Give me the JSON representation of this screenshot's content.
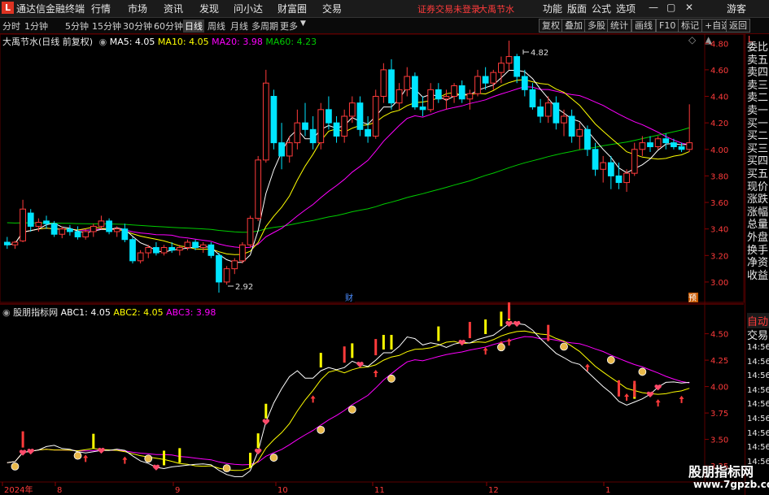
{
  "titlebar": {
    "app_name": "通达信金融终端",
    "menus": [
      "行情",
      "市场",
      "资讯",
      "发现",
      "问小达",
      "财富圈",
      "交易"
    ],
    "notice": "证券交易未登录",
    "stock_name": "大禹节水",
    "right_menus": [
      "功能",
      "版面",
      "公式",
      "选项"
    ],
    "guest": "游客"
  },
  "toolbar": {
    "periods": [
      "分时",
      "1分钟",
      "5分钟",
      "15分钟",
      "30分钟",
      "60分钟",
      "日线",
      "周线",
      "月线",
      "多周期",
      "更多"
    ],
    "active_period": "日线",
    "right_buttons": [
      "复权",
      "叠加",
      "多股",
      "统计",
      "画线",
      "F10",
      "标记",
      "+自选",
      "返回"
    ]
  },
  "main_info": {
    "title": "大禹节水(日线 前复权)",
    "ma5": "MA5: 4.05",
    "ma10": "MA10: 4.05",
    "ma20": "MA20: 3.98",
    "ma60": "MA60: 4.23"
  },
  "sub_info": {
    "title": "股朋指标网",
    "abc1": "ABC1: 4.05",
    "abc2": "ABC2: 4.05",
    "abc3": "ABC3: 3.98"
  },
  "markers": {
    "high_label": "4.82",
    "low_label": "2.92",
    "cai": "财",
    "yu": "预"
  },
  "price_axis": [
    "4.80",
    "4.60",
    "4.40",
    "4.20",
    "4.00",
    "3.80",
    "3.60",
    "3.40",
    "3.20",
    "3.00"
  ],
  "sub_axis": [
    "4.50",
    "4.25",
    "4.00",
    "3.75",
    "3.50",
    "3.25"
  ],
  "date_axis": [
    "2024年",
    "8",
    "9",
    "10",
    "11",
    "12",
    "1"
  ],
  "right_panel": {
    "top_items": [
      "委比",
      "卖五",
      "卖四",
      "卖三",
      "卖二",
      "卖一",
      "买一",
      "买二",
      "买三",
      "买四",
      "买五",
      "现价",
      "涨跌",
      "涨幅",
      "总量",
      "外盘",
      "换手",
      "净资",
      "收益"
    ],
    "bottom_tabs": [
      "自动",
      "交易"
    ],
    "times": [
      "14:56",
      "14:56",
      "14:56",
      "14:56",
      "14:56",
      "14:56",
      "14:56",
      "14:56",
      "14:56"
    ]
  },
  "watermark": {
    "line1": "股朋指标网",
    "line2": "www.7gpzb.com"
  },
  "colors": {
    "up": "#ff3b3b",
    "down": "#00e5ff",
    "ma5": "#ffffff",
    "ma10": "#ffff00",
    "ma20": "#ff00ff",
    "ma60": "#00cc00"
  },
  "chart_data": {
    "type": "candlestick",
    "candles": [
      [
        3.3,
        3.34,
        3.25,
        3.28
      ],
      [
        3.28,
        3.31,
        3.25,
        3.3
      ],
      [
        3.31,
        3.62,
        3.3,
        3.55
      ],
      [
        3.52,
        3.55,
        3.38,
        3.42
      ],
      [
        3.42,
        3.48,
        3.38,
        3.45
      ],
      [
        3.46,
        3.5,
        3.4,
        3.44
      ],
      [
        3.44,
        3.46,
        3.34,
        3.36
      ],
      [
        3.36,
        3.42,
        3.33,
        3.4
      ],
      [
        3.4,
        3.43,
        3.35,
        3.38
      ],
      [
        3.38,
        3.42,
        3.32,
        3.34
      ],
      [
        3.34,
        3.4,
        3.32,
        3.38
      ],
      [
        3.38,
        3.44,
        3.34,
        3.42
      ],
      [
        3.42,
        3.5,
        3.4,
        3.46
      ],
      [
        3.46,
        3.48,
        3.36,
        3.38
      ],
      [
        3.38,
        3.42,
        3.34,
        3.4
      ],
      [
        3.4,
        3.44,
        3.3,
        3.32
      ],
      [
        3.32,
        3.34,
        3.14,
        3.16
      ],
      [
        3.16,
        3.24,
        3.14,
        3.22
      ],
      [
        3.22,
        3.28,
        3.18,
        3.26
      ],
      [
        3.26,
        3.3,
        3.2,
        3.22
      ],
      [
        3.22,
        3.28,
        3.2,
        3.26
      ],
      [
        3.26,
        3.3,
        3.22,
        3.24
      ],
      [
        3.24,
        3.28,
        3.2,
        3.26
      ],
      [
        3.26,
        3.32,
        3.24,
        3.3
      ],
      [
        3.3,
        3.32,
        3.24,
        3.26
      ],
      [
        3.26,
        3.3,
        3.22,
        3.28
      ],
      [
        3.28,
        3.3,
        3.18,
        3.2
      ],
      [
        3.2,
        3.22,
        2.92,
        3.0
      ],
      [
        3.0,
        3.12,
        2.98,
        3.1
      ],
      [
        3.1,
        3.18,
        3.06,
        3.16
      ],
      [
        3.16,
        3.3,
        3.14,
        3.28
      ],
      [
        3.28,
        3.5,
        3.26,
        3.48
      ],
      [
        3.48,
        3.95,
        3.46,
        3.92
      ],
      [
        3.92,
        4.6,
        3.9,
        4.5
      ],
      [
        4.4,
        4.45,
        4.0,
        4.05
      ],
      [
        4.05,
        4.2,
        3.85,
        3.95
      ],
      [
        3.95,
        4.1,
        3.9,
        4.05
      ],
      [
        4.05,
        4.3,
        4.0,
        4.2
      ],
      [
        4.2,
        4.35,
        4.1,
        4.15
      ],
      [
        4.15,
        4.25,
        4.0,
        4.05
      ],
      [
        4.05,
        4.35,
        4.0,
        4.3
      ],
      [
        4.3,
        4.4,
        4.15,
        4.2
      ],
      [
        4.2,
        4.25,
        4.05,
        4.1
      ],
      [
        4.1,
        4.3,
        4.05,
        4.25
      ],
      [
        4.25,
        4.4,
        4.2,
        4.35
      ],
      [
        4.35,
        4.4,
        4.1,
        4.15
      ],
      [
        4.15,
        4.25,
        4.05,
        4.1
      ],
      [
        4.1,
        4.45,
        4.08,
        4.4
      ],
      [
        4.4,
        4.65,
        4.35,
        4.6
      ],
      [
        4.6,
        4.68,
        4.3,
        4.35
      ],
      [
        4.35,
        4.5,
        4.3,
        4.45
      ],
      [
        4.45,
        4.62,
        4.4,
        4.55
      ],
      [
        4.55,
        4.58,
        4.3,
        4.32
      ],
      [
        4.32,
        4.4,
        4.25,
        4.3
      ],
      [
        4.3,
        4.5,
        4.28,
        4.45
      ],
      [
        4.45,
        4.5,
        4.35,
        4.38
      ],
      [
        4.38,
        4.45,
        4.3,
        4.4
      ],
      [
        4.4,
        4.5,
        4.35,
        4.48
      ],
      [
        4.48,
        4.52,
        4.35,
        4.38
      ],
      [
        4.38,
        4.45,
        4.3,
        4.42
      ],
      [
        4.42,
        4.6,
        4.4,
        4.55
      ],
      [
        4.55,
        4.62,
        4.45,
        4.5
      ],
      [
        4.5,
        4.6,
        4.45,
        4.58
      ],
      [
        4.58,
        4.7,
        4.5,
        4.65
      ],
      [
        4.65,
        4.82,
        4.6,
        4.7
      ],
      [
        4.7,
        4.72,
        4.5,
        4.55
      ],
      [
        4.55,
        4.6,
        4.4,
        4.45
      ],
      [
        4.45,
        4.5,
        4.3,
        4.32
      ],
      [
        4.32,
        4.38,
        4.2,
        4.25
      ],
      [
        4.25,
        4.4,
        4.2,
        4.35
      ],
      [
        4.35,
        4.4,
        4.15,
        4.2
      ],
      [
        4.2,
        4.3,
        4.1,
        4.25
      ],
      [
        4.25,
        4.3,
        4.05,
        4.1
      ],
      [
        4.1,
        4.2,
        4.0,
        4.15
      ],
      [
        4.15,
        4.18,
        3.95,
        4.0
      ],
      [
        4.0,
        4.05,
        3.8,
        3.85
      ],
      [
        3.85,
        3.95,
        3.75,
        3.9
      ],
      [
        3.9,
        3.95,
        3.7,
        3.8
      ],
      [
        3.8,
        3.9,
        3.7,
        3.75
      ],
      [
        3.75,
        3.85,
        3.68,
        3.82
      ],
      [
        3.82,
        4.05,
        3.8,
        4.0
      ],
      [
        4.0,
        4.1,
        3.95,
        4.05
      ],
      [
        4.05,
        4.1,
        3.98,
        4.02
      ],
      [
        4.02,
        4.1,
        4.0,
        4.08
      ],
      [
        4.08,
        4.12,
        4.0,
        4.05
      ],
      [
        4.05,
        4.08,
        4.0,
        4.02
      ],
      [
        4.02,
        4.05,
        3.98,
        4.0
      ],
      [
        4.0,
        4.34,
        3.98,
        4.05
      ]
    ],
    "ylim": [
      2.92,
      4.82
    ],
    "series_labels": [
      "MA5",
      "MA10",
      "MA20",
      "MA60"
    ]
  }
}
